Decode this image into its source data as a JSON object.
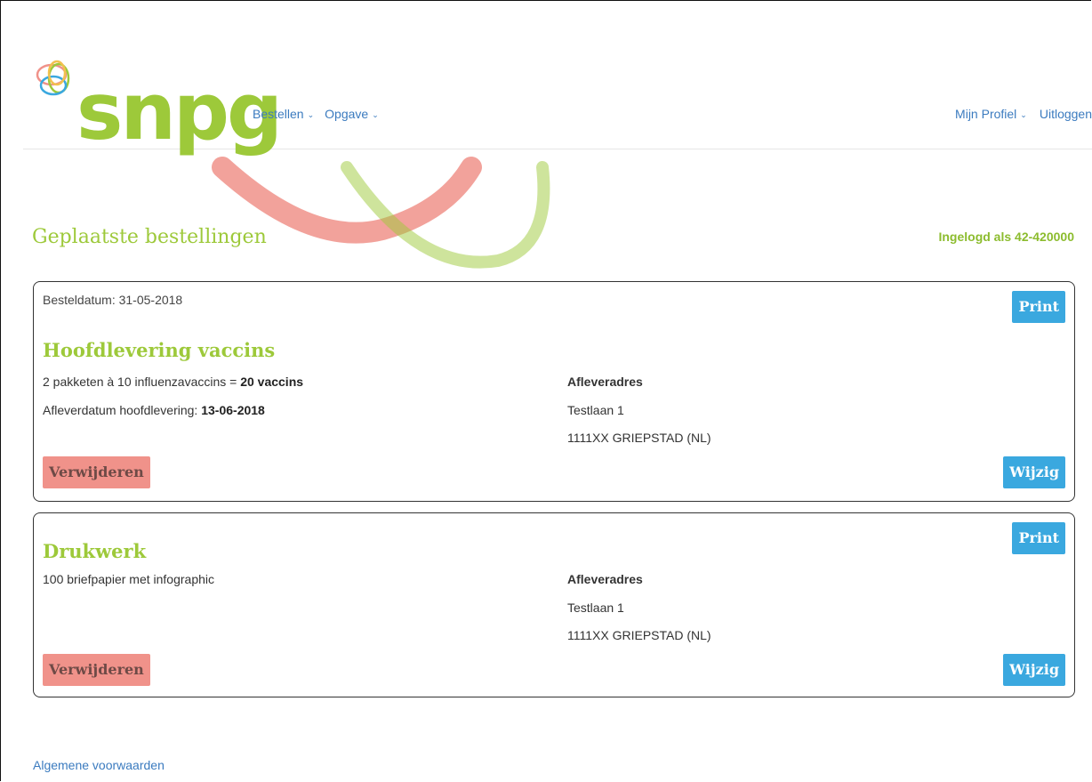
{
  "brand": {
    "name": "snpg",
    "color": "#9dc93a"
  },
  "nav": {
    "left": [
      {
        "label": "Bestellen"
      },
      {
        "label": "Opgave"
      }
    ],
    "right": [
      {
        "label": "Mijn Profiel"
      },
      {
        "label": "Uitloggen"
      }
    ]
  },
  "page": {
    "title": "Geplaatste bestellingen",
    "login_status": "Ingelogd als 42-420000"
  },
  "orders": [
    {
      "order_date": "Besteldatum: 31-05-2018",
      "title": "Hoofdlevering vaccins",
      "line1_prefix": "2 pakketen à 10 influenzavaccins = ",
      "line1_bold": "20 vaccins",
      "line2_prefix": "Afleverdatum hoofdlevering: ",
      "line2_bold": "13-06-2018",
      "address_title": "Afleveradres",
      "address_street": "Testlaan 1",
      "address_city": "1111XX GRIEPSTAD (NL)",
      "print_label": "Print",
      "delete_label": "Verwijderen",
      "edit_label": "Wijzig"
    },
    {
      "title": "Drukwerk",
      "line1": "100 briefpapier met infographic",
      "address_title": "Afleveradres",
      "address_street": "Testlaan 1",
      "address_city": "1111XX GRIEPSTAD (NL)",
      "print_label": "Print",
      "delete_label": "Verwijderen",
      "edit_label": "Wijzig"
    }
  ],
  "footer": {
    "terms_link": "Algemene voorwaarden"
  },
  "colors": {
    "accent_green": "#9dc93a",
    "link_blue": "#3b7bbf",
    "button_blue": "#3aa8df",
    "button_red": "#f0928a"
  }
}
